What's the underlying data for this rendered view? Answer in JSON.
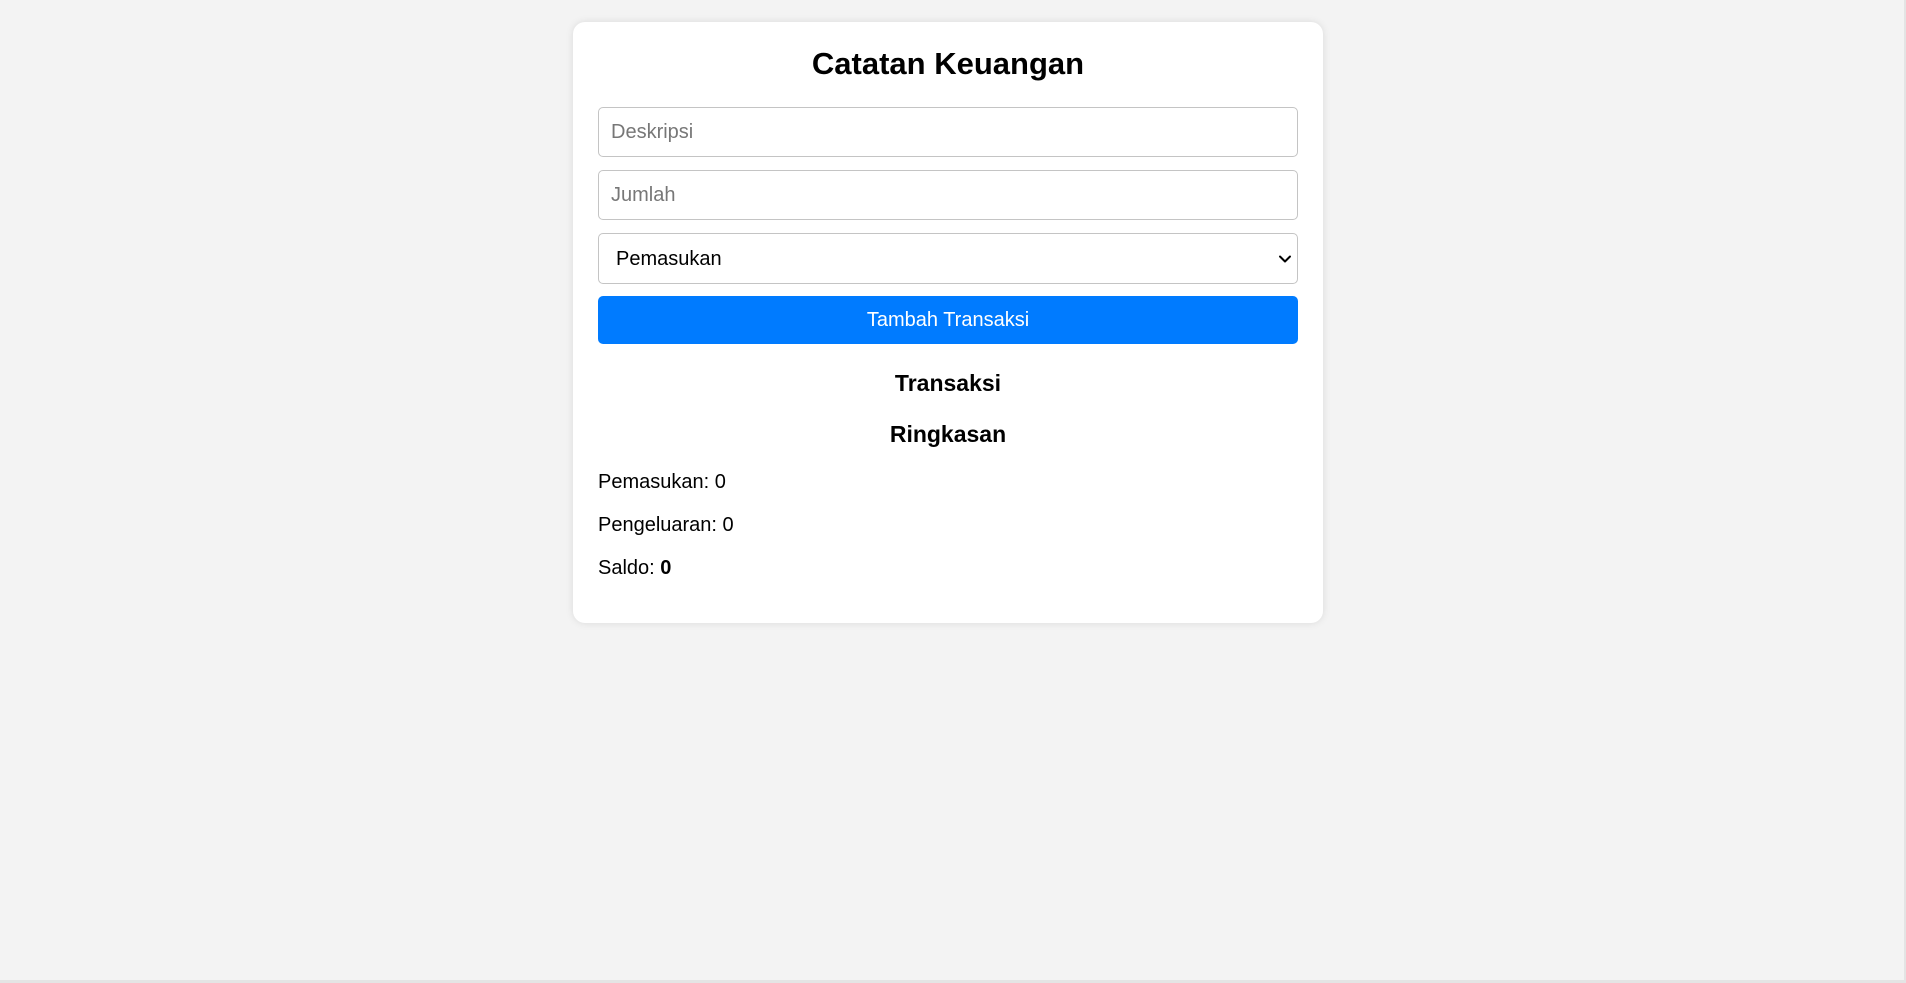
{
  "app": {
    "title": "Catatan Keuangan"
  },
  "form": {
    "description_placeholder": "Deskripsi",
    "description_value": "",
    "amount_placeholder": "Jumlah",
    "amount_value": "",
    "type_selected": "Pemasukan",
    "type_options": [
      "Pemasukan"
    ],
    "add_button_label": "Tambah Transaksi"
  },
  "transactions": {
    "heading": "Transaksi",
    "items": []
  },
  "summary": {
    "heading": "Ringkasan",
    "income_label": "Pemasukan:",
    "income_value": "0",
    "expense_label": "Pengeluaran:",
    "expense_value": "0",
    "balance_label": "Saldo:",
    "balance_value": "0"
  },
  "colors": {
    "page_background": "#f3f3f3",
    "card_background": "#ffffff",
    "button_accent": "#007bff"
  },
  "icons": {
    "select_arrow": "chevron-down-icon"
  }
}
